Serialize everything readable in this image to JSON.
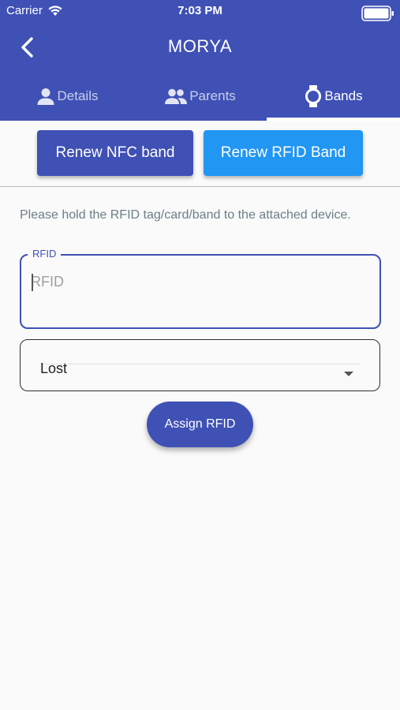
{
  "status_bar": {
    "carrier": "Carrier",
    "time": "7:03 PM",
    "icons": [
      "wifi-icon",
      "battery-icon"
    ]
  },
  "header": {
    "title": "MORYA",
    "back_icon": "chevron-left-icon",
    "background_color": "#3f51b5"
  },
  "tabs": [
    {
      "label": "Details",
      "icon": "person-icon",
      "active": false
    },
    {
      "label": "Parents",
      "icon": "people-icon",
      "active": false
    },
    {
      "label": "Bands",
      "icon": "watch-icon",
      "active": true
    }
  ],
  "actions": {
    "renew_nfc_label": "Renew NFC band",
    "renew_nfc_color": "#3f51b5",
    "renew_rfid_label": "Renew RFID Band",
    "renew_rfid_color": "#2196f3"
  },
  "instruction": "Please hold the RFID tag/card/band to the attached device.",
  "rfid_field": {
    "label": "RFID",
    "placeholder": "RFID",
    "value": ""
  },
  "status_select": {
    "value": "Lost",
    "icon": "arrow-drop-down-icon"
  },
  "assign_button": {
    "label": "Assign RFID"
  }
}
